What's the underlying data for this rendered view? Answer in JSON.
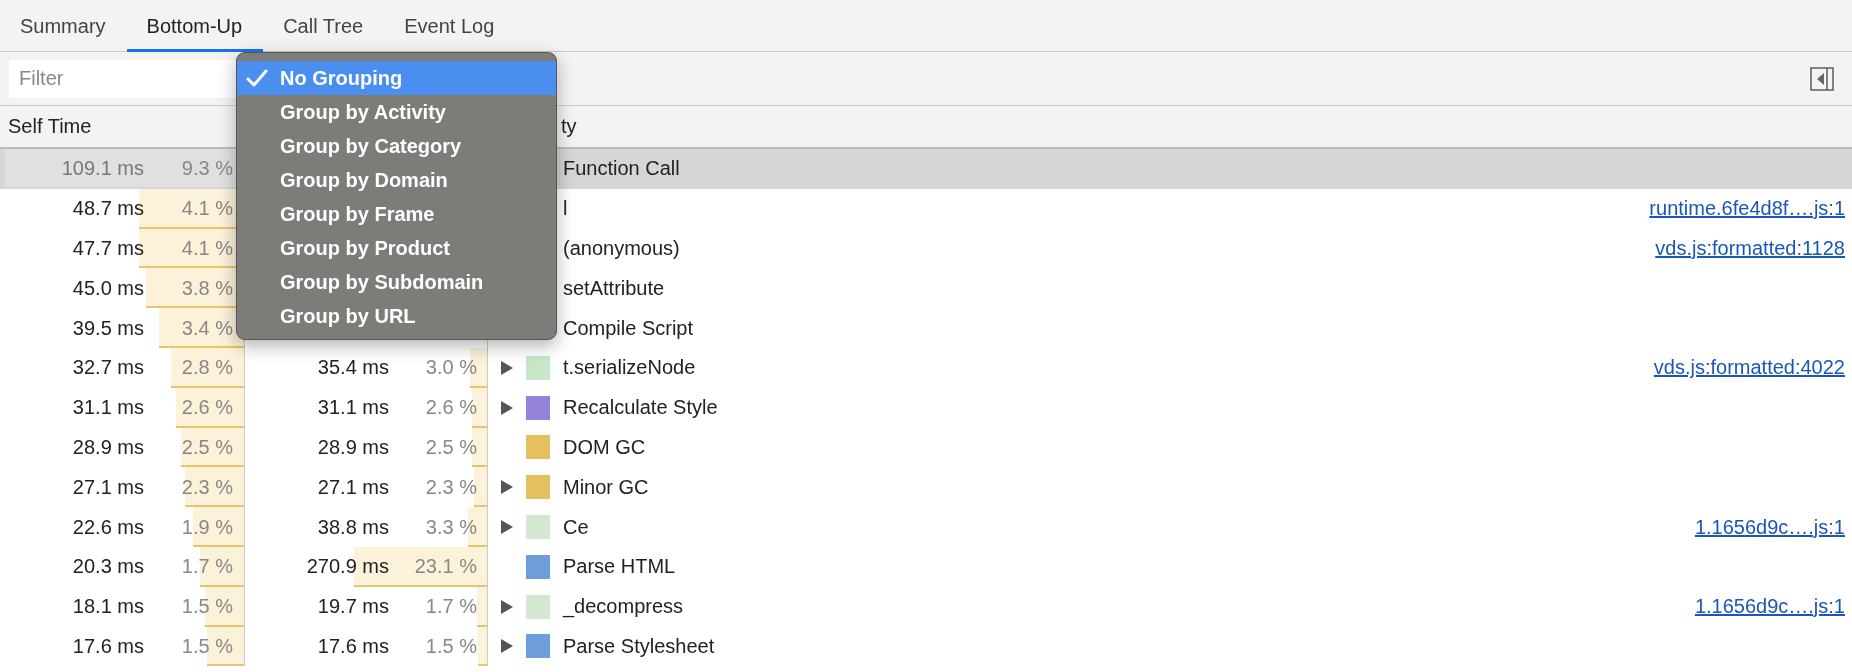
{
  "tabs": [
    {
      "label": "Summary",
      "selected": false
    },
    {
      "label": "Bottom-Up",
      "selected": true
    },
    {
      "label": "Call Tree",
      "selected": false
    },
    {
      "label": "Event Log",
      "selected": false
    }
  ],
  "filter": {
    "placeholder": "Filter"
  },
  "columns": {
    "self_time": "Self Time",
    "activity": "ty"
  },
  "group_menu": [
    {
      "label": "No Grouping",
      "selected": true
    },
    {
      "label": "Group by Activity",
      "selected": false
    },
    {
      "label": "Group by Category",
      "selected": false
    },
    {
      "label": "Group by Domain",
      "selected": false
    },
    {
      "label": "Group by Frame",
      "selected": false
    },
    {
      "label": "Group by Product",
      "selected": false
    },
    {
      "label": "Group by Subdomain",
      "selected": false
    },
    {
      "label": "Group by URL",
      "selected": false
    }
  ],
  "rows": [
    {
      "selected": true,
      "self": {
        "time": "109.1 ms",
        "pct": "9.3 %",
        "level": 0.98
      },
      "activity": "Function Call"
    },
    {
      "selected": false,
      "self": {
        "time": "48.7 ms",
        "pct": "4.1 %",
        "level": 0.43
      },
      "activity": "l",
      "link": "runtime.6fe4d8f….js:1"
    },
    {
      "selected": false,
      "self": {
        "time": "47.7 ms",
        "pct": "4.1 %",
        "level": 0.43
      },
      "activity": "(anonymous)",
      "link": "vds.js:formatted:1128"
    },
    {
      "selected": false,
      "self": {
        "time": "45.0 ms",
        "pct": "3.8 %",
        "level": 0.4
      },
      "activity": "setAttribute"
    },
    {
      "selected": false,
      "self": {
        "time": "39.5 ms",
        "pct": "3.4 %",
        "level": 0.35
      },
      "activity": "Compile Script"
    },
    {
      "selected": false,
      "self": {
        "time": "32.7 ms",
        "pct": "2.8 %",
        "level": 0.3
      },
      "total": {
        "time": "35.4 ms",
        "pct": "3.0 %",
        "level": 0.07
      },
      "expandable": true,
      "color": "#c7e7c7",
      "activity": "t.serializeNode",
      "link": "vds.js:formatted:4022"
    },
    {
      "selected": false,
      "self": {
        "time": "31.1 ms",
        "pct": "2.6 %",
        "level": 0.28
      },
      "total": {
        "time": "31.1 ms",
        "pct": "2.6 %",
        "level": 0.06
      },
      "expandable": true,
      "color": "#9381da",
      "activity": "Recalculate Style"
    },
    {
      "selected": false,
      "self": {
        "time": "28.9 ms",
        "pct": "2.5 %",
        "level": 0.26
      },
      "total": {
        "time": "28.9 ms",
        "pct": "2.5 %",
        "level": 0.06
      },
      "expandable": false,
      "color": "#e6c060",
      "activity": "DOM GC"
    },
    {
      "selected": false,
      "self": {
        "time": "27.1 ms",
        "pct": "2.3 %",
        "level": 0.24
      },
      "total": {
        "time": "27.1 ms",
        "pct": "2.3 %",
        "level": 0.055
      },
      "expandable": true,
      "color": "#e6c060",
      "activity": "Minor GC"
    },
    {
      "selected": false,
      "self": {
        "time": "22.6 ms",
        "pct": "1.9 %",
        "level": 0.21
      },
      "total": {
        "time": "38.8 ms",
        "pct": "3.3 %",
        "level": 0.08
      },
      "expandable": true,
      "color": "#d2e8d0",
      "activity": "Ce",
      "link": "1.1656d9c….js:1"
    },
    {
      "selected": false,
      "self": {
        "time": "20.3 ms",
        "pct": "1.7 %",
        "level": 0.18
      },
      "total": {
        "time": "270.9 ms",
        "pct": "23.1 %",
        "level": 0.55
      },
      "expandable": false,
      "color": "#6f9ddc",
      "activity": "Parse HTML"
    },
    {
      "selected": false,
      "self": {
        "time": "18.1 ms",
        "pct": "1.5 %",
        "level": 0.16
      },
      "total": {
        "time": "19.7 ms",
        "pct": "1.7 %",
        "level": 0.04
      },
      "expandable": true,
      "color": "#d2e8d0",
      "activity": "_decompress",
      "link": "1.1656d9c….js:1"
    },
    {
      "selected": false,
      "self": {
        "time": "17.6 ms",
        "pct": "1.5 %",
        "level": 0.15
      },
      "total": {
        "time": "17.6 ms",
        "pct": "1.5 %",
        "level": 0.036
      },
      "expandable": true,
      "color": "#6f9ddc",
      "activity": "Parse Stylesheet"
    }
  ]
}
